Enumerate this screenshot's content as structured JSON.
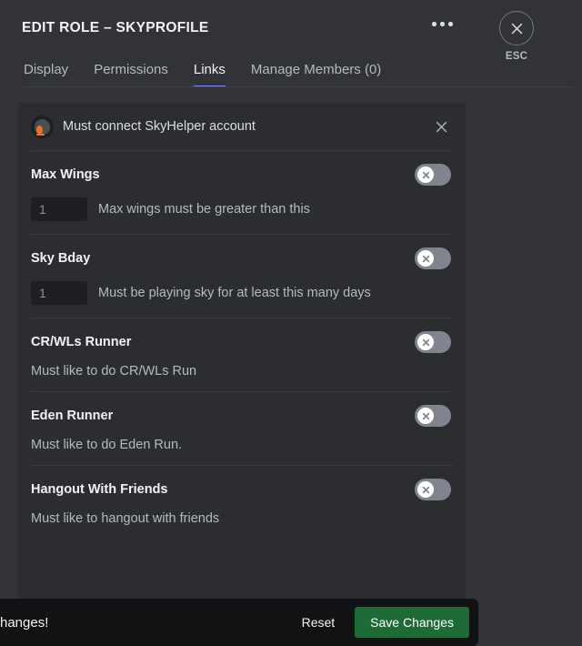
{
  "header": {
    "title": "EDIT ROLE – SKYPROFILE",
    "more_icon": "more-horizontal-icon",
    "esc_label": "ESC",
    "esc_icon": "close-x-icon"
  },
  "tabs": [
    {
      "label": "Display",
      "active": false
    },
    {
      "label": "Permissions",
      "active": false
    },
    {
      "label": "Links",
      "active": true
    },
    {
      "label": "Manage Members (0)",
      "active": false
    }
  ],
  "connect_banner": {
    "avatar_icon": "skyhelper-avatar-icon",
    "text": "Must connect SkyHelper account",
    "close_icon": "close-x-icon"
  },
  "settings": [
    {
      "name": "Max Wings",
      "toggle_state": "off",
      "toggle_icon": "toggle-off-x-icon",
      "has_input": true,
      "input_value": "1",
      "hint": "Max wings must be greater than this"
    },
    {
      "name": "Sky Bday",
      "toggle_state": "off",
      "toggle_icon": "toggle-off-x-icon",
      "has_input": true,
      "input_value": "1",
      "hint": "Must be playing sky for at least this many days"
    },
    {
      "name": "CR/WLs Runner",
      "toggle_state": "off",
      "toggle_icon": "toggle-off-x-icon",
      "has_input": false,
      "input_value": "",
      "hint": "Must like to do CR/WLs Run"
    },
    {
      "name": "Eden Runner",
      "toggle_state": "off",
      "toggle_icon": "toggle-off-x-icon",
      "has_input": false,
      "input_value": "",
      "hint": "Must like to do Eden Run."
    },
    {
      "name": "Hangout With Friends",
      "toggle_state": "off",
      "toggle_icon": "toggle-off-x-icon",
      "has_input": false,
      "input_value": "",
      "hint": "Must like to hangout with friends"
    }
  ],
  "save_bar": {
    "message": "hanges!",
    "reset_label": "Reset",
    "save_label": "Save Changes"
  },
  "colors": {
    "app_background": "#313338",
    "card_background": "#2b2d31",
    "active_tab_accent": "#7d84ed",
    "save_button_green": "#1f6b38",
    "save_bar_background": "#111214",
    "toggle_track_off": "#80848e",
    "avatar_accent_orange": "#e8742c"
  }
}
